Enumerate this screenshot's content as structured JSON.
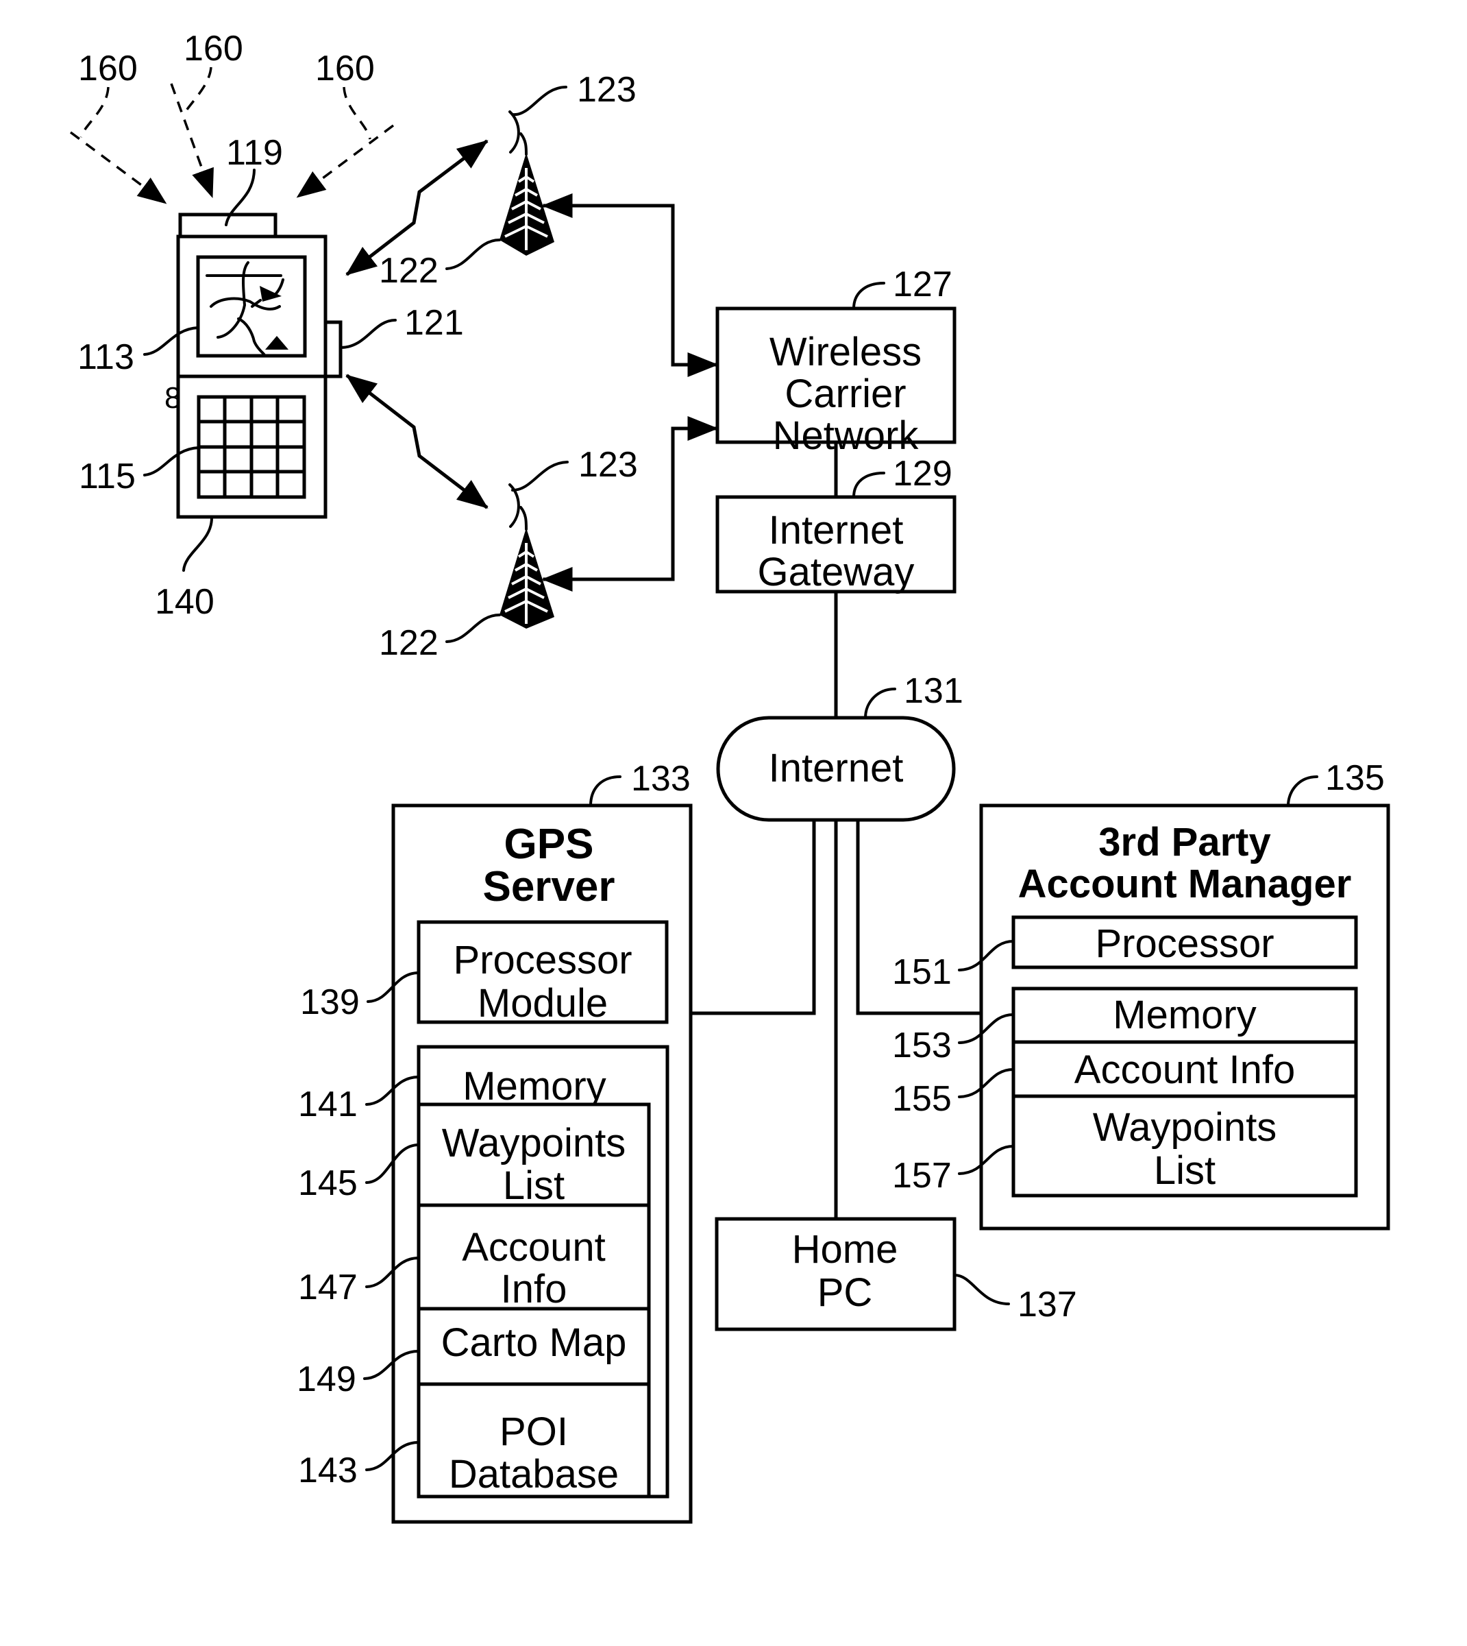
{
  "figure": {
    "reference_labels": {
      "satellite_signal_left": "160",
      "satellite_signal_middle": "160",
      "satellite_signal_right": "160",
      "gps_antenna": "119",
      "display": "113",
      "keypad": "115",
      "side_button_mark": "8",
      "device": "140",
      "transceiver": "121",
      "tower_top": "122",
      "antenna_top": "123",
      "tower_bottom": "122",
      "antenna_bottom": "123",
      "wireless_carrier_network": "127",
      "internet_gateway": "129",
      "internet": "131",
      "gps_server": "133",
      "third_party_account_manager": "135",
      "home_pc": "137",
      "processor_module": "139",
      "memory": "141",
      "waypoints_list": "145",
      "account_info": "147",
      "carto_map": "149",
      "poi_database": "143",
      "tp_processor": "151",
      "tp_memory": "153",
      "tp_account_info": "155",
      "tp_waypoints_list": "157"
    },
    "nodes": {
      "wireless_carrier_network": [
        "Wireless",
        "Carrier",
        "Network"
      ],
      "internet_gateway": [
        "Internet",
        "Gateway"
      ],
      "internet": "Internet",
      "home_pc": [
        "Home",
        "PC"
      ],
      "gps_server": {
        "title": [
          "GPS",
          "Server"
        ],
        "processor_module": [
          "Processor",
          "Module"
        ],
        "memory": "Memory",
        "waypoints_list": [
          "Waypoints",
          "List"
        ],
        "account_info": [
          "Account",
          "Info"
        ],
        "carto_map": "Carto Map",
        "poi_database": [
          "POI",
          "Database"
        ]
      },
      "third_party_account_manager": {
        "title": [
          "3rd Party",
          "Account Manager"
        ],
        "processor": "Processor",
        "memory": "Memory",
        "account_info": "Account Info",
        "waypoints_list": [
          "Waypoints",
          "List"
        ]
      }
    }
  }
}
